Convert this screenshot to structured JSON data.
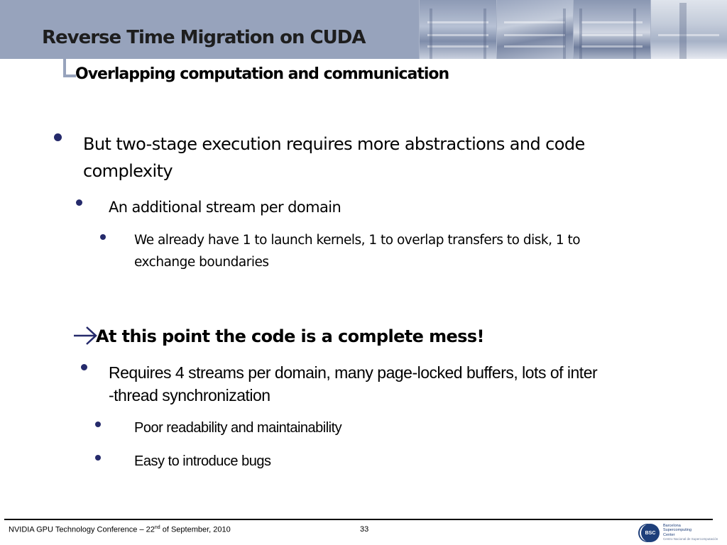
{
  "header": {
    "title": "Reverse Time Migration on CUDA",
    "subtitle": "Overlapping computation and communication",
    "photo_strip_icon": "building-photos-banner",
    "bar_color": "#97a3bc"
  },
  "content": {
    "bullet_color": "#252a6b",
    "level1": {
      "line1": "But two-stage execution requires more abstractions and code",
      "line2": "complexity"
    },
    "level2": {
      "text": "An additional stream per domain"
    },
    "level3": {
      "line1": "We already have 1 to launch kernels, 1 to overlap transfers to disk, 1 to",
      "line2": "exchange boundaries"
    },
    "conclusion": {
      "arrow_icon": "right-arrow-icon",
      "text": "At this point the code is a complete mess!"
    },
    "conclusion_bullet": {
      "line1": "Requires 4 streams per domain, many page-locked buffers, lots of inter",
      "line2": "-thread synchronization"
    },
    "sub_bullets": [
      "Poor readability and maintainability",
      "Easy to introduce bugs"
    ]
  },
  "footer": {
    "conference_prefix": "NVIDIA GPU Technology Conference – 22",
    "conference_sup": "nd",
    "conference_suffix": " of September, 2010",
    "page_number": "33",
    "logo": {
      "abbr": "BSC",
      "line1": "Barcelona",
      "line2": "Supercomputing",
      "line3": "Center",
      "line4": "Centro Nacional de Supercomputación"
    }
  }
}
